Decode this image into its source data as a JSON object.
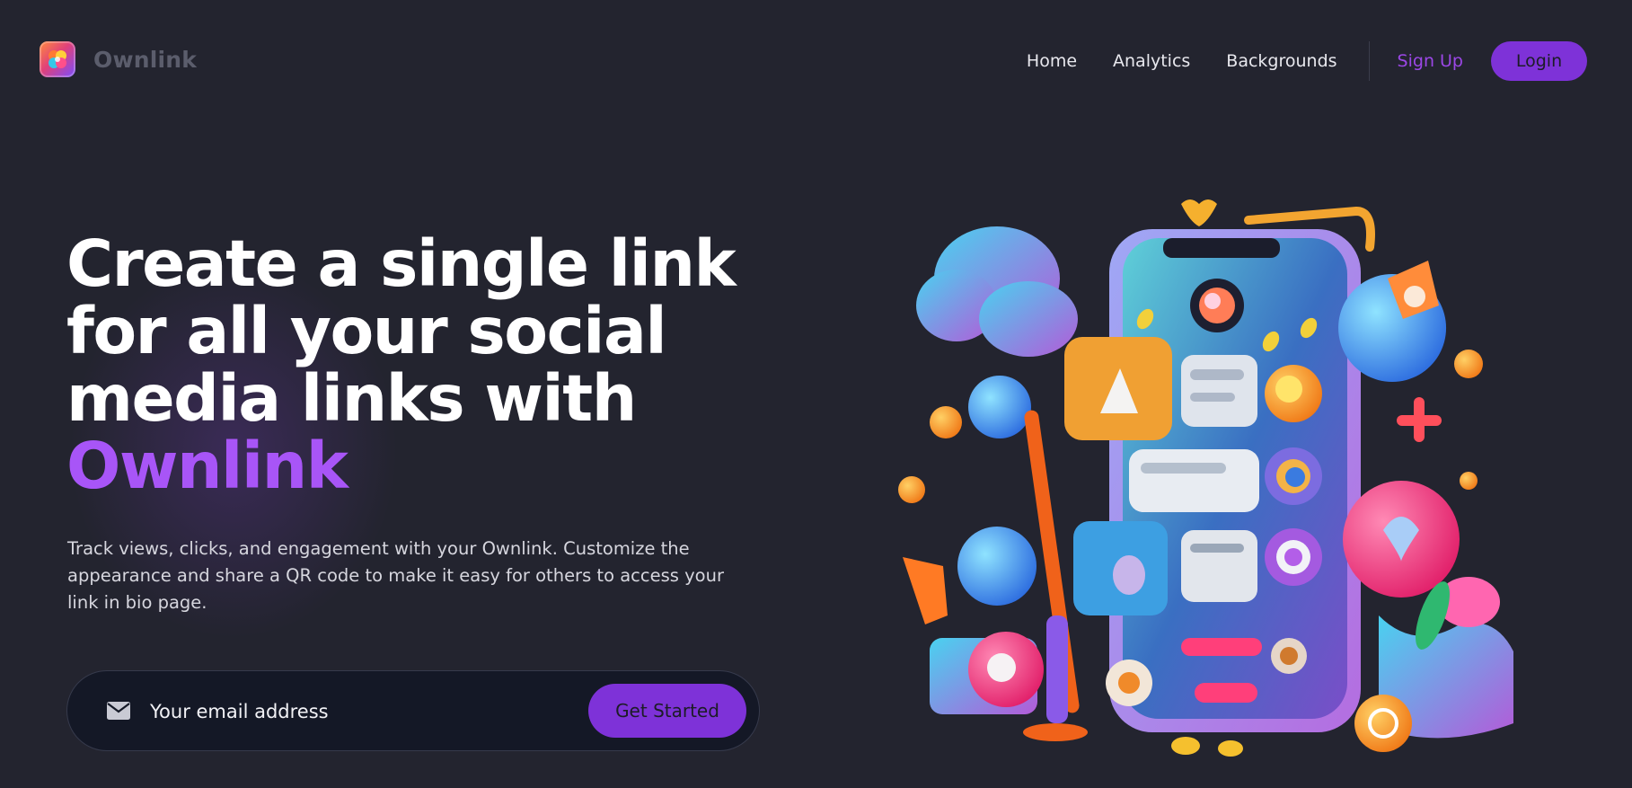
{
  "nav": {
    "brand": "Ownlink",
    "links": [
      {
        "label": "Home"
      },
      {
        "label": "Analytics"
      },
      {
        "label": "Backgrounds"
      }
    ],
    "signup_label": "Sign Up",
    "login_label": "Login",
    "logo_icon": "flower-logo-icon"
  },
  "hero": {
    "title_lines": [
      "Create a single link",
      "for all your social",
      "media links with"
    ],
    "title_accent": "Ownlink",
    "description": "Track views, clicks, and engagement with your Ownlink. Customize the appearance and share a QR code to make it easy for others to access your link in bio page.",
    "email_placeholder": "Your email address",
    "email_icon": "envelope-icon",
    "cta_label": "Get Started"
  },
  "colors": {
    "background": "#23242f",
    "accent": "#a855f7",
    "button": "#7e32d8",
    "input_bg": "#141826"
  },
  "illustration": {
    "subject": "3d-phone-social-icons-illustration"
  }
}
